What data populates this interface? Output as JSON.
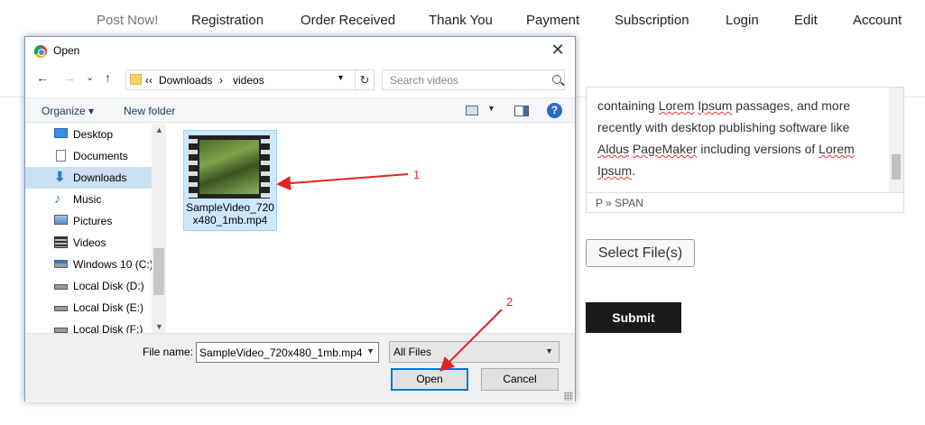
{
  "site": {
    "nav": [
      "Post Now!",
      "Registration",
      "Order Received",
      "Thank You",
      "Payment",
      "Subscription",
      "Login",
      "Edit",
      "Account"
    ],
    "editor": {
      "line1_pre": "containing ",
      "line1_w1": "Lorem",
      "line1_mid": " ",
      "line1_w2": "Ipsum",
      "line1_post": " passages, and more",
      "line2": "recently with desktop publishing software like",
      "line3_w1": "Aldus",
      "line3_mid": " ",
      "line3_w2": "PageMaker",
      "line3_post": " including versions of ",
      "line3_w3": "Lorem",
      "line4_w1": "Ipsum",
      "line4_post": ".",
      "status": "P » SPAN"
    },
    "select_files_label": "Select File(s)",
    "submit_label": "Submit"
  },
  "dialog": {
    "title": "Open",
    "close_glyph": "✕",
    "nav_glyphs": {
      "back": "←",
      "forward": "→",
      "recent": "⌄",
      "up": "↑",
      "refresh": "↻"
    },
    "breadcrumb": {
      "overflow": "‹‹",
      "parts": [
        "Downloads",
        "videos"
      ],
      "separator": "›"
    },
    "search_placeholder": "Search videos",
    "toolbar": {
      "organize": "Organize ▾",
      "new_folder": "New folder",
      "help": "?"
    },
    "nav_items": [
      {
        "label": "Desktop",
        "icon": "desktop-icon"
      },
      {
        "label": "Documents",
        "icon": "documents-icon"
      },
      {
        "label": "Downloads",
        "icon": "downloads-icon",
        "selected": true
      },
      {
        "label": "Music",
        "icon": "music-icon"
      },
      {
        "label": "Pictures",
        "icon": "pictures-icon"
      },
      {
        "label": "Videos",
        "icon": "videos-icon"
      },
      {
        "label": "Windows 10 (C:)",
        "icon": "windows-drive-icon"
      },
      {
        "label": "Local Disk (D:)",
        "icon": "drive-icon"
      },
      {
        "label": "Local Disk (E:)",
        "icon": "drive-icon"
      },
      {
        "label": "Local Disk (F:)",
        "icon": "drive-icon"
      }
    ],
    "file": {
      "name_line1": "SampleVideo_720",
      "name_line2": "x480_1mb.mp4"
    },
    "file_name_label": "File name:",
    "file_name_value": "SampleVideo_720x480_1mb.mp4",
    "file_type_value": "All Files",
    "open_label": "Open",
    "cancel_label": "Cancel"
  },
  "annotations": {
    "label1": "1",
    "label2": "2",
    "color": "#e52222"
  }
}
